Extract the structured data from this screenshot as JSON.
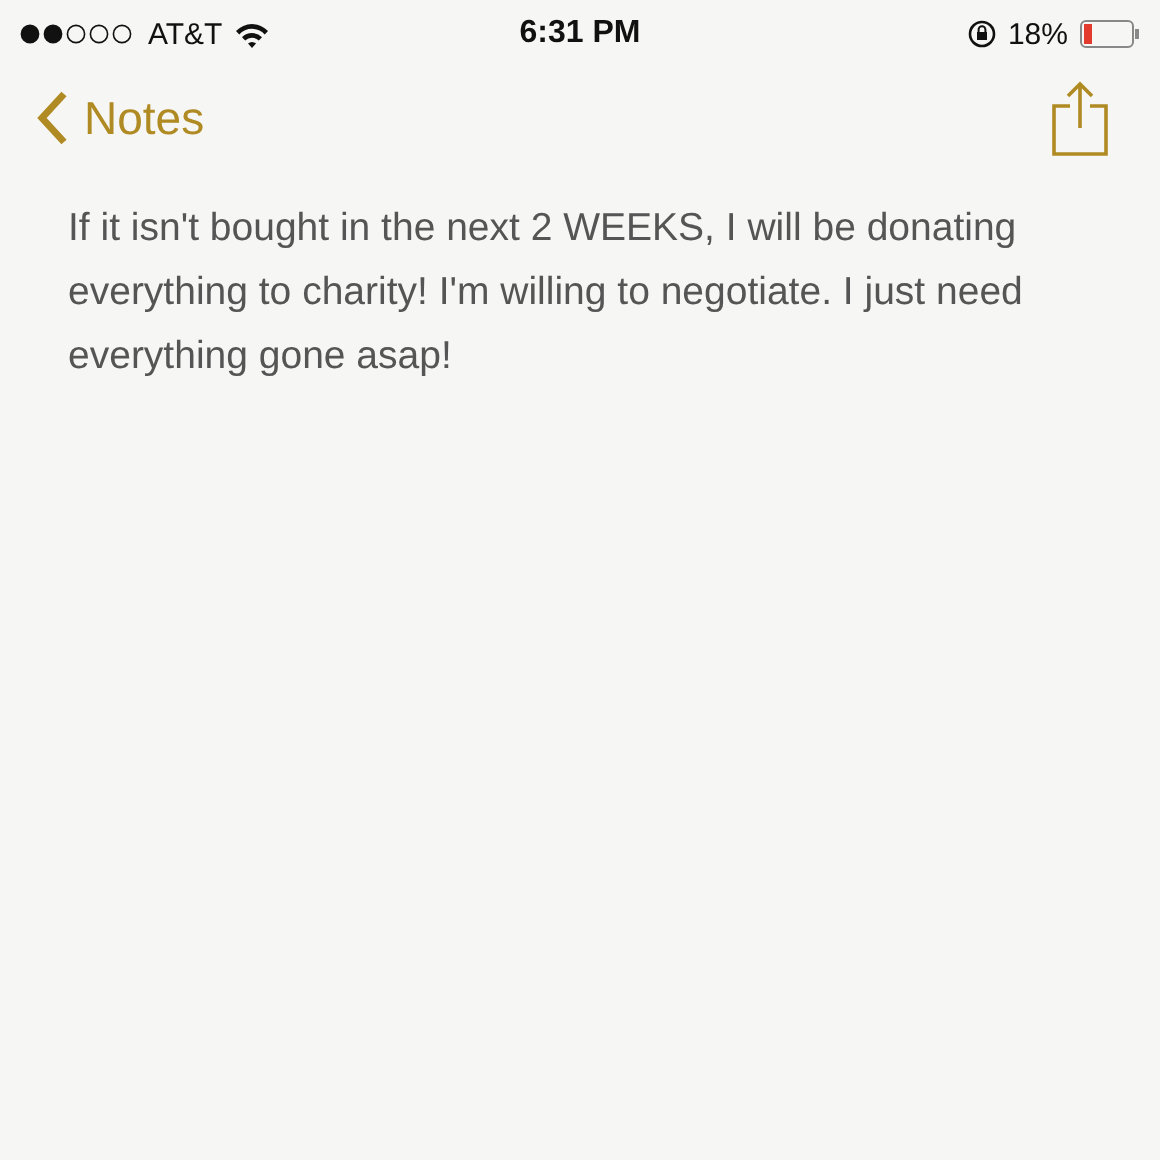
{
  "status_bar": {
    "carrier": "AT&T",
    "time": "6:31 PM",
    "battery": "18%"
  },
  "nav": {
    "back": "Notes"
  },
  "note": {
    "text": "If it isn't bought in the next 2 WEEKS, I will be donating everything to charity! I'm willing to negotiate. I just need everything gone asap!"
  }
}
